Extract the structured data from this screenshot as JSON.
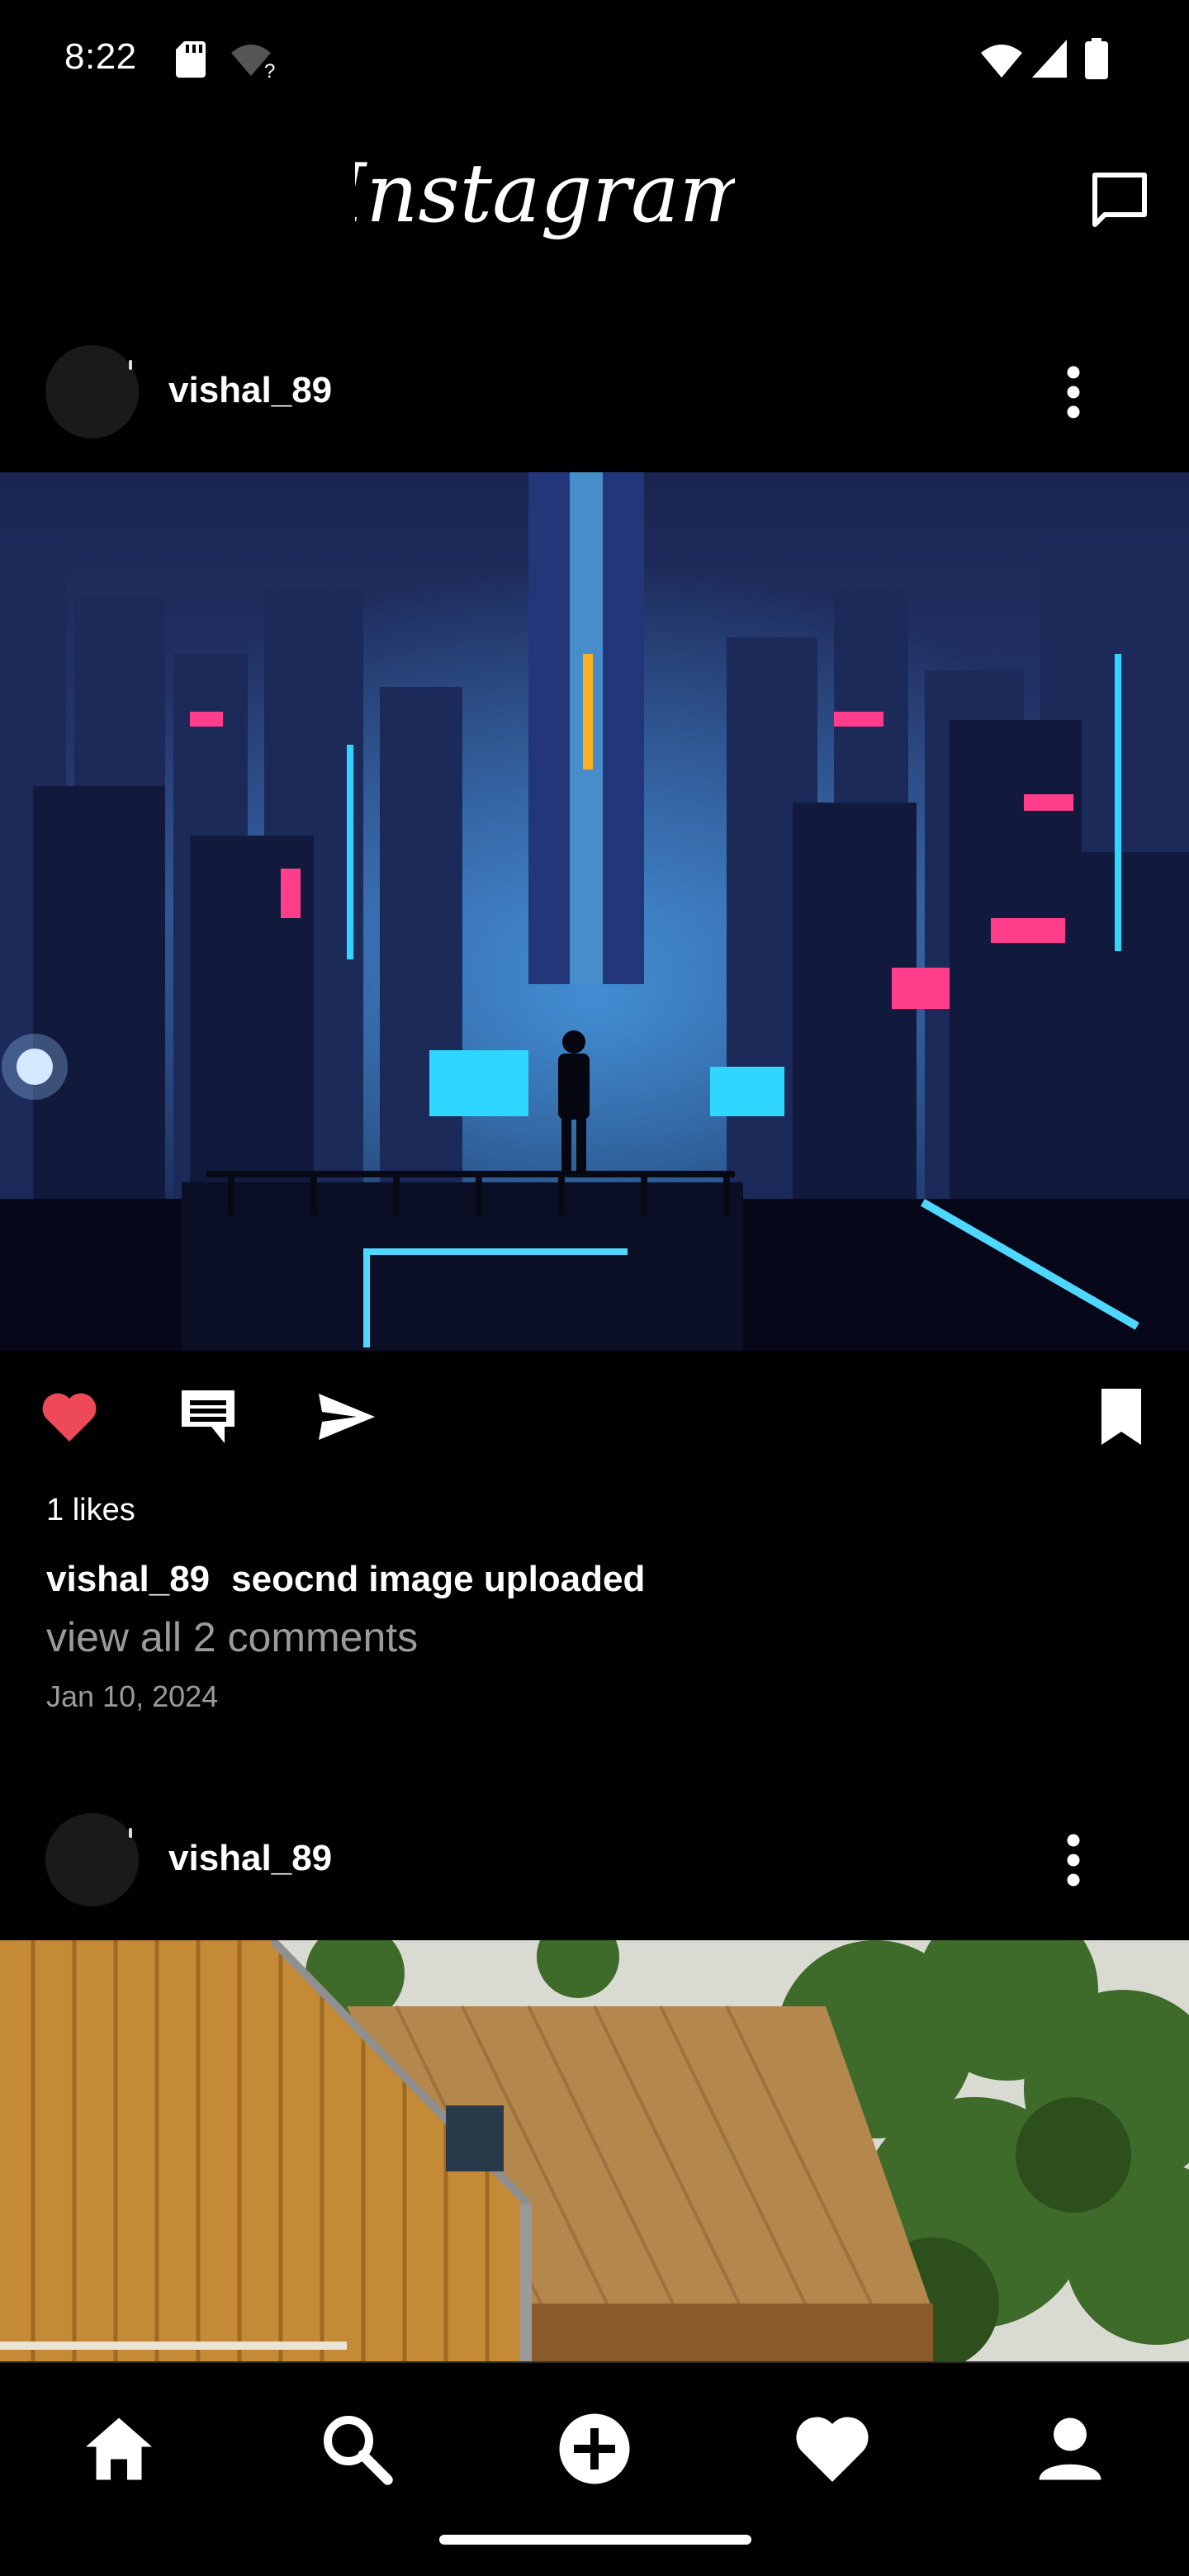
{
  "status_bar": {
    "time": "8:22",
    "icons": [
      "sd-card-icon",
      "wifi-unknown-icon",
      "wifi-icon",
      "signal-icon",
      "battery-icon"
    ]
  },
  "header": {
    "logo_text": "Instagram",
    "icons": [
      "direct-message-icon"
    ]
  },
  "posts": [
    {
      "username": "vishal_89",
      "image_description_icon": "city-night-image",
      "likes": "1 likes",
      "caption_user": "vishal_89",
      "caption_text": "seocnd image uploaded",
      "view_comments": "view all 2 comments",
      "date": "Jan 10, 2024",
      "liked": true
    },
    {
      "username": "vishal_89",
      "image_description_icon": "wooden-house-image"
    }
  ],
  "bottom_nav": {
    "items": [
      "home-icon",
      "search-icon",
      "add-post-icon",
      "likes-icon",
      "profile-icon"
    ]
  },
  "colors": {
    "background": "#000000",
    "like_red": "#ed4956",
    "muted_text": "#9a9a9a"
  }
}
